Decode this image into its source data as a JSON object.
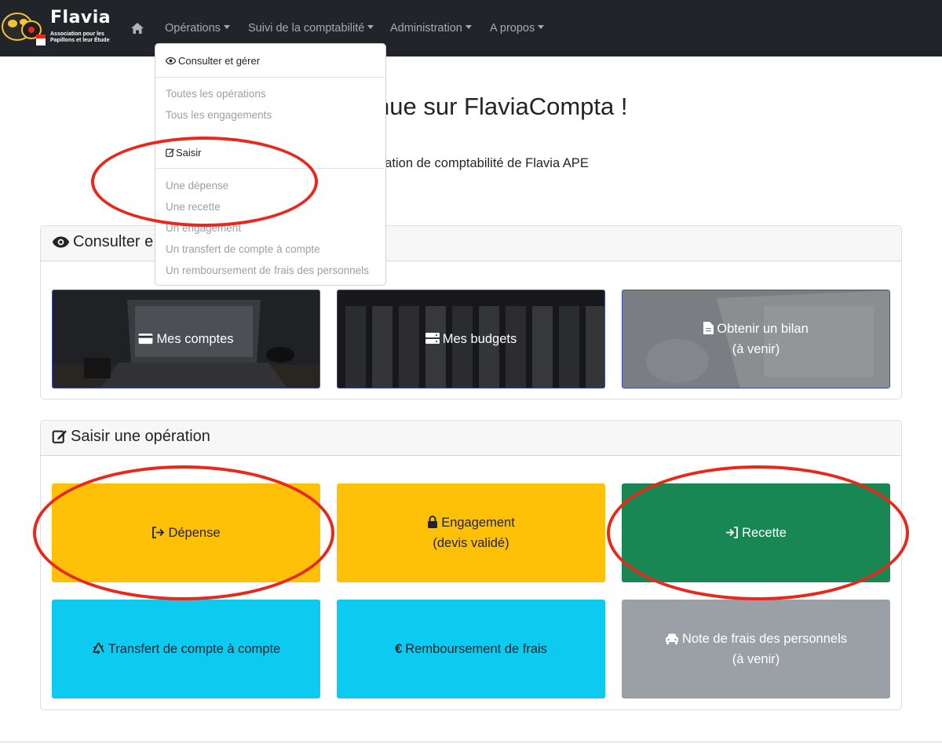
{
  "brand": {
    "name": "Flavia",
    "tagline": "Association pour les Papillons et leur Étude"
  },
  "nav": {
    "home_icon": "home-icon",
    "items": [
      {
        "label": "Opérations"
      },
      {
        "label": "Suivi de la comptabilité"
      },
      {
        "label": "Administration"
      },
      {
        "label": "A propos"
      }
    ]
  },
  "dropdown": {
    "consult_header": "Consulter et gérer",
    "consult_items": [
      "Toutes les opérations",
      "Tous les engagements"
    ],
    "enter_header": "Saisir",
    "enter_items": [
      "Une dépense",
      "Une recette",
      "Un engagement",
      "Un transfert de compte à compte",
      "Un remboursement de frais des personnels"
    ]
  },
  "page": {
    "title_visible": "nue sur FlaviaCompta !",
    "subtitle_visible": "cation de comptabilité de Flavia APE"
  },
  "consult_card": {
    "title_visible": "Consulter e",
    "tiles": [
      {
        "label": "Mes comptes",
        "icon": "card-icon"
      },
      {
        "label": "Mes budgets",
        "icon": "server-icon"
      },
      {
        "label": "Obtenir un bilan",
        "sublabel": "(à venir)",
        "icon": "file-icon"
      }
    ]
  },
  "enter_card": {
    "title": "Saisir une opération",
    "tiles": [
      {
        "label": "Dépense",
        "icon": "sign-out-icon",
        "color": "#ffc107"
      },
      {
        "label": "Engagement",
        "sublabel": "(devis validé)",
        "icon": "lock-icon",
        "color": "#ffc107"
      },
      {
        "label": "Recette",
        "icon": "sign-in-icon",
        "color": "#198754"
      },
      {
        "label": "Transfert de compte à compte",
        "icon": "recycle-icon",
        "color": "#0dcaf0"
      },
      {
        "label": "Remboursement de frais",
        "icon": "euro-icon",
        "color": "#0dcaf0"
      },
      {
        "label": "Note de frais des personnels",
        "sublabel": "(à venir)",
        "icon": "car-icon",
        "color": "#9aa0a6"
      }
    ]
  },
  "colors": {
    "navbar": "#212529",
    "annotation": "#e8281b"
  }
}
